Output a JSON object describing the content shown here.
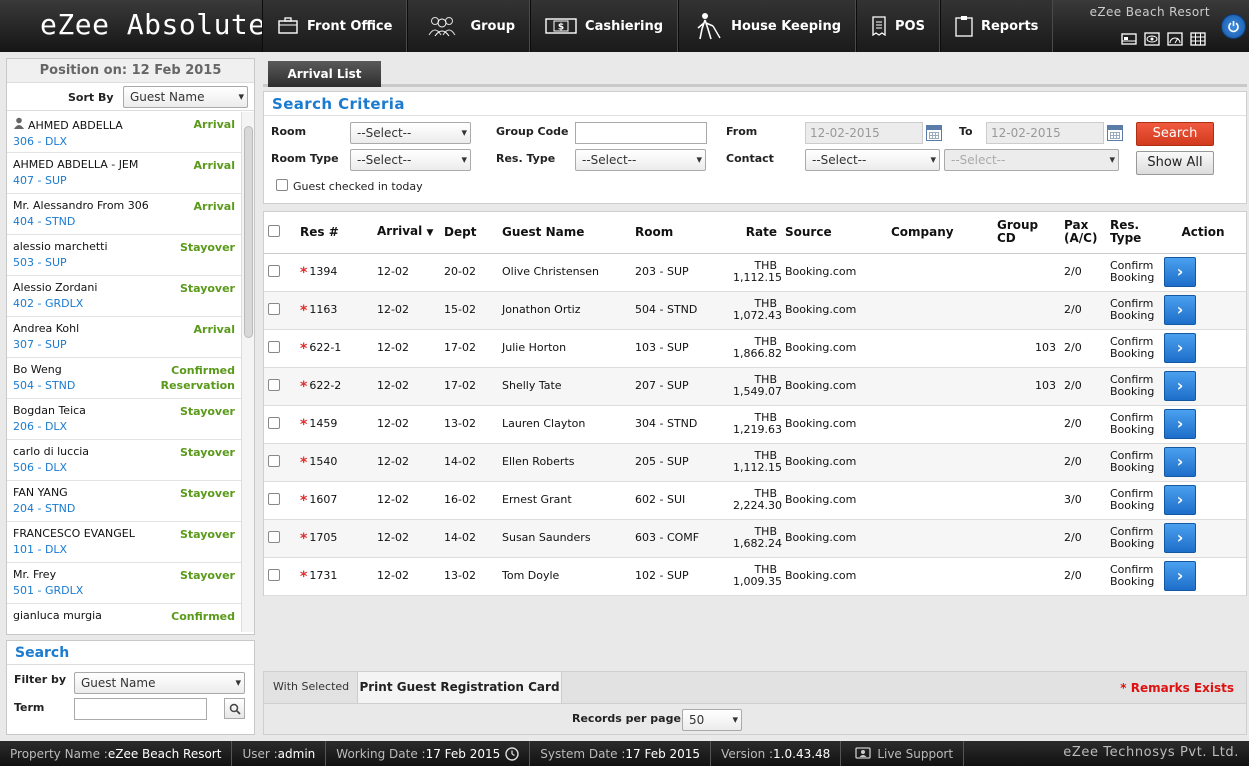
{
  "header": {
    "app_title": "eZee Absolute",
    "resort_name": "eZee Beach Resort",
    "nav": [
      {
        "label": "Front Office",
        "icon": "briefcase-icon"
      },
      {
        "label": "Group",
        "icon": "group-icon"
      },
      {
        "label": "Cashiering",
        "icon": "cash-icon"
      },
      {
        "label": "House Keeping",
        "icon": "housekeeping-icon"
      },
      {
        "label": "POS",
        "icon": "receipt-icon"
      },
      {
        "label": "Reports",
        "icon": "clipboard-icon"
      }
    ],
    "quick_icons": [
      "bed-icon",
      "eye-icon",
      "dashboard-icon",
      "grid-icon"
    ],
    "power_icon": "power-icon"
  },
  "left": {
    "position_header": "Position on: 12 Feb 2015",
    "sort_by_label": "Sort By",
    "sort_by_value": "Guest Name",
    "guests": [
      {
        "name": "AHMED ABDELLA",
        "room": "306 - DLX",
        "status": "Arrival",
        "user_icon": true
      },
      {
        "name": "AHMED ABDELLA - JEM",
        "room": "407 - SUP",
        "status": "Arrival"
      },
      {
        "name": "Mr. Alessandro From 306",
        "room": "404 - STND",
        "status": "Arrival"
      },
      {
        "name": "alessio marchetti",
        "room": "503 - SUP",
        "status": "Stayover"
      },
      {
        "name": "Alessio Zordani",
        "room": "402 - GRDLX",
        "status": "Stayover"
      },
      {
        "name": "Andrea Kohl",
        "room": "307 - SUP",
        "status": "Arrival"
      },
      {
        "name": "Bo Weng",
        "room": "504 - STND",
        "status": "Confirmed",
        "status2": "Reservation"
      },
      {
        "name": "Bogdan Teica",
        "room": "206 - DLX",
        "status": "Stayover"
      },
      {
        "name": "carlo di luccia",
        "room": "506 - DLX",
        "status": "Stayover"
      },
      {
        "name": "FAN YANG",
        "room": "204 - STND",
        "status": "Stayover"
      },
      {
        "name": "FRANCESCO EVANGEL",
        "room": "101 - DLX",
        "status": "Stayover"
      },
      {
        "name": "Mr. Frey",
        "room": "501 - GRDLX",
        "status": "Stayover"
      },
      {
        "name": "gianluca murgia",
        "room": "",
        "status": "Confirmed"
      }
    ],
    "search": {
      "title": "Search",
      "filter_by_label": "Filter by",
      "filter_by_value": "Guest Name",
      "term_label": "Term",
      "term_value": ""
    }
  },
  "main": {
    "tab": "Arrival List",
    "criteria": {
      "title": "Search Criteria",
      "room_label": "Room",
      "room_value": "--Select--",
      "room_type_label": "Room Type",
      "room_type_value": "--Select--",
      "group_code_label": "Group Code",
      "group_code_value": "",
      "res_type_label": "Res. Type",
      "res_type_value": "--Select--",
      "from_label": "From",
      "from_value": "12-02-2015",
      "to_label": "To",
      "to_value": "12-02-2015",
      "contact_label": "Contact",
      "contact_value": "--Select--",
      "contact_value2": "--Select--",
      "search_button": "Search",
      "show_all_button": "Show All",
      "checked_today_label": "Guest checked in today"
    },
    "columns": [
      "Res #",
      "Arrival",
      "Dept",
      "Guest Name",
      "Room",
      "Rate",
      "Source",
      "Company",
      "Group CD",
      "Pax (A/C)",
      "Res. Type",
      "Action"
    ],
    "rows": [
      {
        "res": "1394",
        "arrival": "12-02",
        "dept": "20-02",
        "guest": "Olive Christensen",
        "room": "203 - SUP",
        "rate_cur": "THB",
        "rate": "1,112.15",
        "source": "Booking.com",
        "company": "",
        "group": "",
        "pax": "2/0",
        "res_type": "Confirm Booking"
      },
      {
        "res": "1163",
        "arrival": "12-02",
        "dept": "15-02",
        "guest": "Jonathon Ortiz",
        "room": "504 - STND",
        "rate_cur": "THB",
        "rate": "1,072.43",
        "source": "Booking.com",
        "company": "",
        "group": "",
        "pax": "2/0",
        "res_type": "Confirm Booking"
      },
      {
        "res": "622-1",
        "arrival": "12-02",
        "dept": "17-02",
        "guest": "Julie Horton",
        "room": "103 - SUP",
        "rate_cur": "THB",
        "rate": "1,866.82",
        "source": "Booking.com",
        "company": "",
        "group": "103",
        "pax": "2/0",
        "res_type": "Confirm Booking"
      },
      {
        "res": "622-2",
        "arrival": "12-02",
        "dept": "17-02",
        "guest": "Shelly Tate",
        "room": "207 - SUP",
        "rate_cur": "THB",
        "rate": "1,549.07",
        "source": "Booking.com",
        "company": "",
        "group": "103",
        "pax": "2/0",
        "res_type": "Confirm Booking"
      },
      {
        "res": "1459",
        "arrival": "12-02",
        "dept": "13-02",
        "guest": "Lauren Clayton",
        "room": "304 - STND",
        "rate_cur": "THB",
        "rate": "1,219.63",
        "source": "Booking.com",
        "company": "",
        "group": "",
        "pax": "2/0",
        "res_type": "Confirm Booking"
      },
      {
        "res": "1540",
        "arrival": "12-02",
        "dept": "14-02",
        "guest": "Ellen Roberts",
        "room": "205 - SUP",
        "rate_cur": "THB",
        "rate": "1,112.15",
        "source": "Booking.com",
        "company": "",
        "group": "",
        "pax": "2/0",
        "res_type": "Confirm Booking"
      },
      {
        "res": "1607",
        "arrival": "12-02",
        "dept": "16-02",
        "guest": "Ernest Grant",
        "room": "602 - SUI",
        "rate_cur": "THB",
        "rate": "2,224.30",
        "source": "Booking.com",
        "company": "",
        "group": "",
        "pax": "3/0",
        "res_type": "Confirm Booking"
      },
      {
        "res": "1705",
        "arrival": "12-02",
        "dept": "14-02",
        "guest": "Susan Saunders",
        "room": "603 - COMF",
        "rate_cur": "THB",
        "rate": "1,682.24",
        "source": "Booking.com",
        "company": "",
        "group": "",
        "pax": "2/0",
        "res_type": "Confirm Booking"
      },
      {
        "res": "1731",
        "arrival": "12-02",
        "dept": "13-02",
        "guest": "Tom Doyle",
        "room": "102 - SUP",
        "rate_cur": "THB",
        "rate": "1,009.35",
        "source": "Booking.com",
        "company": "",
        "group": "",
        "pax": "2/0",
        "res_type": "Confirm Booking"
      }
    ],
    "with_selected": "With Selected",
    "print_card": "Print Guest Registration Card",
    "remarks": "* Remarks Exists",
    "records_per_page_label": "Records per page",
    "records_per_page_value": "50"
  },
  "status": {
    "property": "Property Name : ",
    "property_val": "eZee Beach Resort",
    "user": "User : ",
    "user_val": "admin",
    "working_date": "Working Date : ",
    "working_date_val": "17 Feb 2015",
    "system_date": "System Date : ",
    "system_date_val": "17 Feb 2015",
    "version": "Version : ",
    "version_val": "1.0.43.48",
    "live_support": "Live Support",
    "company": "eZee Technosys Pvt. Ltd."
  },
  "colors": {
    "accent_blue": "#1a7bd0",
    "status_green": "#5a9a1a",
    "search_red": "#e04a2e",
    "remark_red": "#e01010"
  }
}
